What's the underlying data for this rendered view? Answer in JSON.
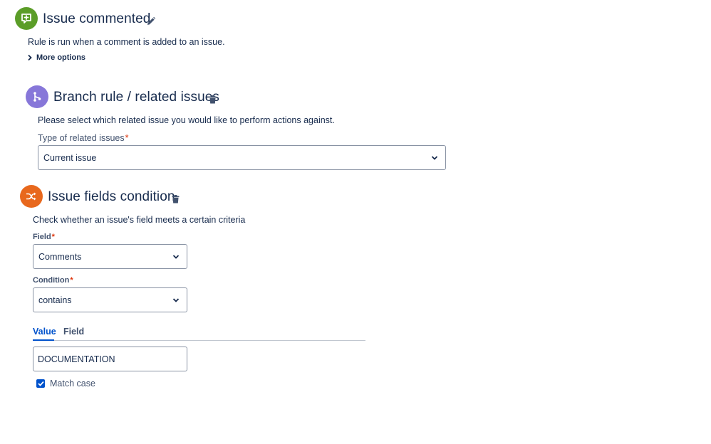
{
  "trigger": {
    "title": "Issue commented",
    "description": "Rule is run when a comment is added to an issue.",
    "more_options": "More options",
    "color": "#5b9d28"
  },
  "branch": {
    "title": "Branch rule / related issues",
    "description": "Please select which related issue you would like to perform actions against.",
    "type_label": "Type of related issues",
    "required_mark": "*",
    "type_value": "Current issue",
    "color": "#8777d9"
  },
  "condition": {
    "title": "Issue fields condition",
    "description": "Check whether an issue's field meets a certain criteria",
    "field_label": "Field",
    "field_value": "Comments",
    "condition_label": "Condition",
    "condition_value": "contains",
    "required_mark": "*",
    "tabs": [
      {
        "label": "Value",
        "active": true
      },
      {
        "label": "Field",
        "active": false
      }
    ],
    "value_input": "DOCUMENTATION",
    "match_case_label": "Match case",
    "match_case_checked": true,
    "color": "#e8681d"
  },
  "icons": {
    "trigger": "comment-plus-icon",
    "branch": "branch-icon",
    "condition": "shuffle-icon",
    "edit": "pencil-icon",
    "delete": "trash-icon",
    "expand": "chevron-right-icon",
    "dropdown": "chevron-down-icon",
    "checkbox": "checkmark-icon"
  }
}
